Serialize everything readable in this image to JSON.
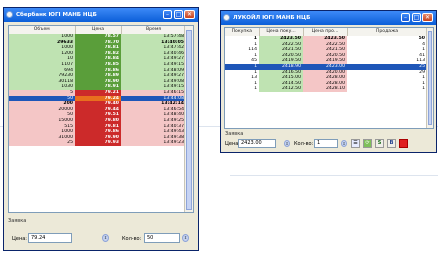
{
  "window1": {
    "title": "Сбербанк ЮГІ МАНБ НЦБ",
    "columns": [
      "Объем",
      "Цена",
      "Время"
    ],
    "rows": [
      {
        "vol": "1000",
        "price": "78.57",
        "time": "13:57:48",
        "side": "buy"
      },
      {
        "vol": "29633",
        "price": "78.70",
        "time": "13:40:05",
        "side": "buy",
        "bold": true
      },
      {
        "vol": "1000",
        "price": "78.81",
        "time": "13:47:42",
        "side": "buy"
      },
      {
        "vol": "1200",
        "price": "78.82",
        "time": "13:40:46",
        "side": "buy"
      },
      {
        "vol": "10",
        "price": "78.84",
        "time": "13:49:27",
        "side": "buy"
      },
      {
        "vol": "1107",
        "price": "78.85",
        "time": "13:49:15",
        "side": "buy"
      },
      {
        "vol": "694",
        "price": "78.86",
        "time": "13:48:09",
        "side": "buy"
      },
      {
        "vol": "79230",
        "price": "78.89",
        "time": "13:49:27",
        "side": "buy"
      },
      {
        "vol": "30118",
        "price": "78.90",
        "time": "13:49:08",
        "side": "buy"
      },
      {
        "vol": "1030",
        "price": "78.91",
        "time": "13:49:15",
        "side": "buy"
      },
      {
        "vol": "5",
        "price": "79.21",
        "time": "13:46:15",
        "side": "sell"
      },
      {
        "vol": "50",
        "price": "79.24",
        "time": "13:44:08",
        "side": "current"
      },
      {
        "vol": "200",
        "price": "79.40",
        "time": "13:42:14",
        "side": "sell",
        "bold": true
      },
      {
        "vol": "20000",
        "price": "79.44",
        "time": "13:46:54",
        "side": "sell"
      },
      {
        "vol": "50",
        "price": "79.51",
        "time": "13:48:40",
        "side": "sell"
      },
      {
        "vol": "15000",
        "price": "79.80",
        "time": "13:49:25",
        "side": "sell"
      },
      {
        "vol": "515",
        "price": "79.81",
        "time": "13:40:37",
        "side": "sell"
      },
      {
        "vol": "1000",
        "price": "79.86",
        "time": "13:49:43",
        "side": "sell"
      },
      {
        "vol": "31000",
        "price": "79.90",
        "time": "13:49:38",
        "side": "sell"
      },
      {
        "vol": "25",
        "price": "79.93",
        "time": "13:49:23",
        "side": "sell"
      }
    ],
    "order_section": "Заявка",
    "price_label": "Цена:",
    "price_value": "79.24",
    "qty_label": "Кол-во:",
    "qty_value": "50"
  },
  "window2": {
    "title": "ЛУКОЙЛ ЮГІ МАНБ НЦБ",
    "columns": [
      "Покупка",
      "Цена поку...",
      "Цена про...",
      "Продажа"
    ],
    "rows": [
      {
        "buy": "1",
        "bprice": "2423.50",
        "sprice": "2423.50",
        "sell": "50",
        "bold": true
      },
      {
        "buy": "1",
        "bprice": "2422.50",
        "sprice": "2422.50",
        "sell": "4"
      },
      {
        "buy": "114",
        "bprice": "2421.50",
        "sprice": "2421.50",
        "sell": "1"
      },
      {
        "buy": "1",
        "bprice": "2420.50",
        "sprice": "2420.50",
        "sell": "41"
      },
      {
        "buy": "45",
        "bprice": "2419.50",
        "sprice": "2419.50",
        "sell": "113"
      },
      {
        "buy": "1",
        "bprice": "2418.90",
        "sprice": "2423.00",
        "sell": "25",
        "current": true
      },
      {
        "buy": "1",
        "bprice": "2416.50",
        "sprice": "2420.00",
        "sell": "29"
      },
      {
        "buy": "13",
        "bprice": "2415.00",
        "sprice": "2428.00",
        "sell": "1"
      },
      {
        "buy": "1",
        "bprice": "2414.50",
        "sprice": "2428.00",
        "sell": "1"
      },
      {
        "buy": "1",
        "bprice": "2412.50",
        "sprice": "2428.10",
        "sell": "1"
      }
    ],
    "order_section": "Заявка",
    "price_label": "Цена:",
    "price_value": "2423.00",
    "qty_label": "Кол-во:",
    "qty_value": "1",
    "btn_s": "S",
    "btn_b": "B"
  }
}
